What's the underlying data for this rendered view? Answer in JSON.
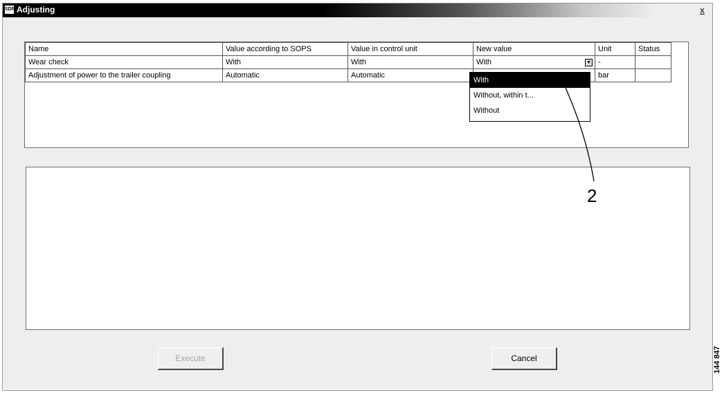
{
  "window": {
    "title": "Adjusting",
    "icon_text": "SDP",
    "close_label": "x"
  },
  "table": {
    "headers": [
      "Name",
      "Value according to SOPS",
      "Value in control unit",
      "New value",
      "Unit",
      "Status"
    ],
    "rows": [
      {
        "name": "Wear check",
        "sops": "With",
        "control": "With",
        "new": "With",
        "unit": "-",
        "status": ""
      },
      {
        "name": "Adjustment of power to the trailer coupling",
        "sops": "Automatic",
        "control": "Automatic",
        "new": "",
        "unit": "bar",
        "status": ""
      }
    ]
  },
  "dropdown": {
    "options": [
      "With",
      "Without, within t...",
      "Without"
    ],
    "selected": "With"
  },
  "buttons": {
    "execute": "Execute",
    "cancel": "Cancel"
  },
  "annotation": {
    "callout": "2",
    "figure_code": "144 847"
  }
}
